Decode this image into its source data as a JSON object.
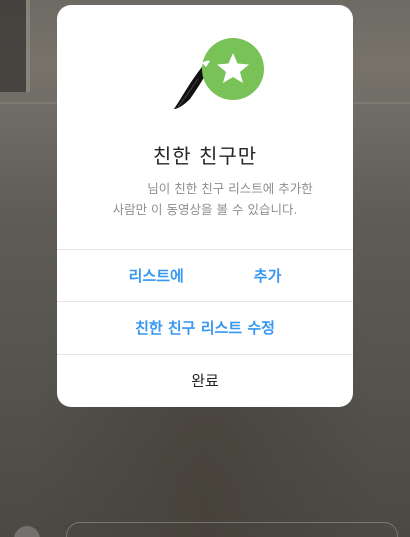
{
  "dialog": {
    "title": "친한 친구만",
    "description_line1": "님이 친한 친구 리스트에 추가한",
    "description_line2": "사람만 이 동영상을 볼 수 있습니다.",
    "buttons": {
      "add_to_list_prefix": "리스트에",
      "add_to_list_suffix": "추가",
      "edit_list": "친한 친구 리스트 수정",
      "done": "완료"
    },
    "icon": "close-friends-star-icon"
  },
  "colors": {
    "accent_blue": "#3897f0",
    "star_badge_green": "#78c257",
    "title_text": "#262626",
    "secondary_text": "#8e8e8e"
  }
}
